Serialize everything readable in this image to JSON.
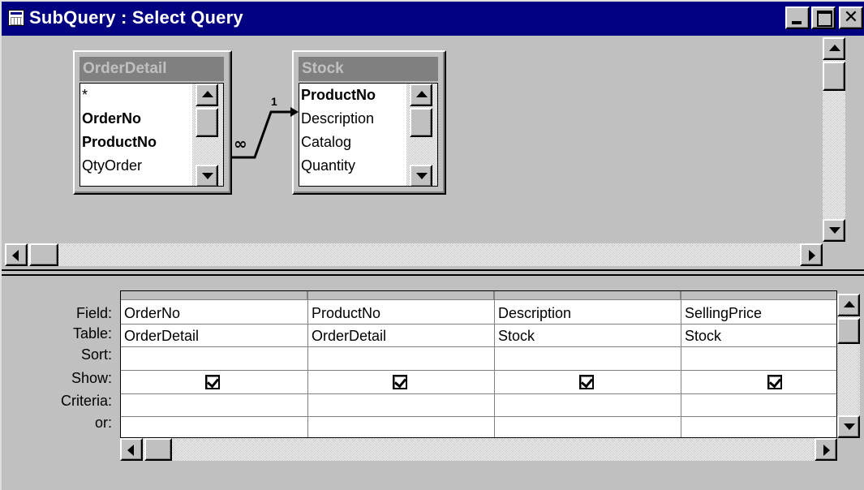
{
  "window": {
    "title": "SubQuery : Select Query",
    "close_glyph": "✕"
  },
  "tables": [
    {
      "title": "OrderDetail",
      "fields": [
        {
          "label": "*",
          "key": false
        },
        {
          "label": "OrderNo",
          "key": true
        },
        {
          "label": "ProductNo",
          "key": true
        },
        {
          "label": "QtyOrder",
          "key": false
        }
      ]
    },
    {
      "title": "Stock",
      "fields": [
        {
          "label": "ProductNo",
          "key": true
        },
        {
          "label": "Description",
          "key": false
        },
        {
          "label": "Catalog",
          "key": false
        },
        {
          "label": "Quantity",
          "key": false
        }
      ]
    }
  ],
  "join": {
    "one_label": "1",
    "many_label": "∞"
  },
  "grid": {
    "row_labels": [
      "Field:",
      "Table:",
      "Sort:",
      "Show:",
      "Criteria:",
      "or:"
    ],
    "columns": [
      {
        "field": "OrderNo",
        "table": "OrderDetail",
        "sort": "",
        "show": true
      },
      {
        "field": "ProductNo",
        "table": "OrderDetail",
        "sort": "",
        "show": true
      },
      {
        "field": "Description",
        "table": "Stock",
        "sort": "",
        "show": true
      },
      {
        "field": "SellingPrice",
        "table": "Stock",
        "sort": "",
        "show": true
      }
    ]
  },
  "colors": {
    "titlebar": "#000080",
    "face": "#c0c0c0",
    "table_title_bg": "#808080"
  },
  "icons": [
    "query-window-icon",
    "minimize-icon",
    "maximize-icon",
    "close-icon",
    "scroll-up-icon",
    "scroll-down-icon",
    "scroll-left-icon",
    "scroll-right-icon",
    "checkbox-checked-icon"
  ]
}
